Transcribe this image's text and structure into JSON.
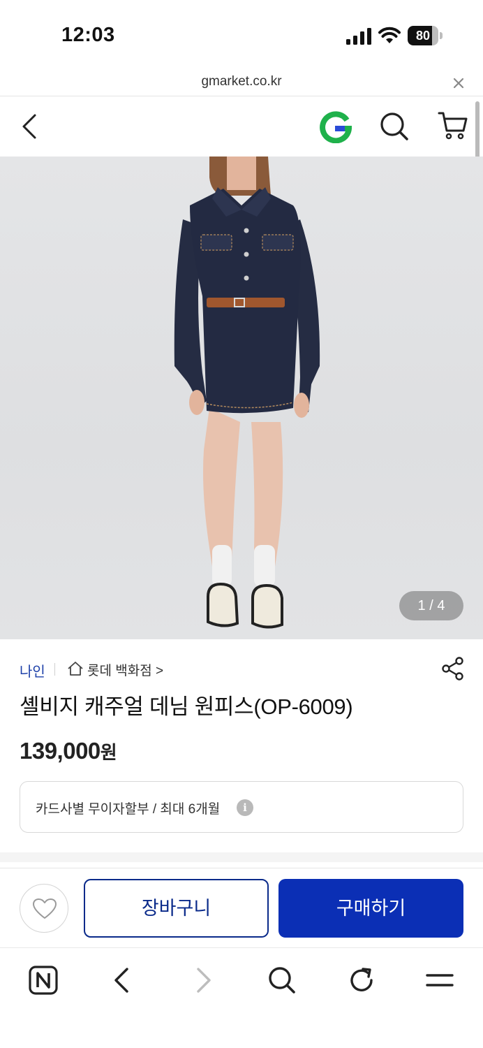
{
  "status_bar": {
    "time": "12:03",
    "battery": "80",
    "battery_level": 0.8
  },
  "url_bar": {
    "url": "gmarket.co.kr"
  },
  "header": {
    "logo_text": "G",
    "logo_color": "#1fb14b",
    "logo_accent": "#2a4bd7"
  },
  "product": {
    "image_counter": "1 / 4",
    "brand": "나인",
    "store": "롯데 백화점",
    "store_chevron": ">",
    "title": "셸비지 캐주얼 데님 원피스(OP-6009)",
    "price": "139,000",
    "price_unit": "원",
    "installment": "카드사별 무이자할부 / 최대 6개월",
    "info_icon": "i"
  },
  "actions": {
    "cart_label": "장바구니",
    "buy_label": "구매하기",
    "primary_color": "#0b2fb5"
  },
  "icons": {
    "back": "chevron-left-icon",
    "search": "search-icon",
    "cart": "cart-icon",
    "share": "share-icon",
    "wish": "heart-icon",
    "store": "home-icon"
  }
}
